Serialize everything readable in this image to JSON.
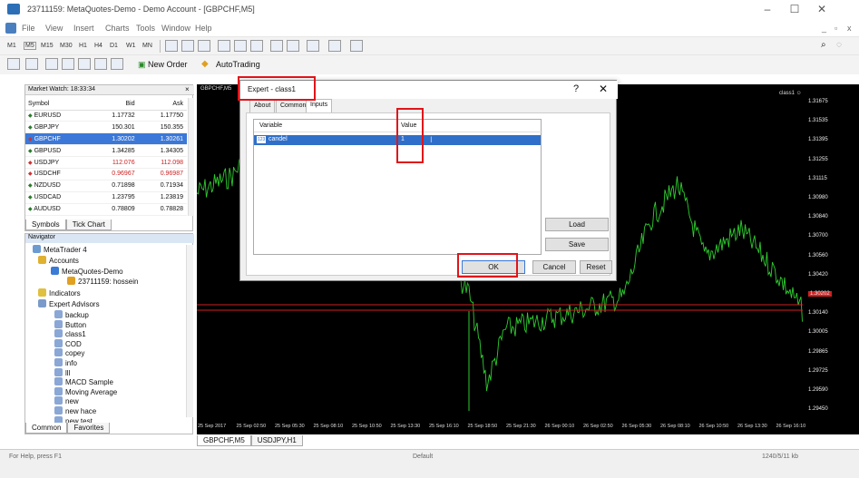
{
  "window": {
    "title": "23711159: MetaQuotes-Demo - Demo Account - [GBPCHF,M5]",
    "minimize": "–",
    "maximize": "☐",
    "close": "✕",
    "sub_minimize": "_",
    "sub_restore": "▫",
    "sub_close": "x"
  },
  "menu": [
    "File",
    "View",
    "Insert",
    "Charts",
    "Tools",
    "Window",
    "Help"
  ],
  "timeframes": [
    "M1",
    "M5",
    "M15",
    "M30",
    "H1",
    "H4",
    "D1",
    "W1",
    "MN"
  ],
  "toolbar": {
    "new_order": "New Order",
    "auto_trading": "AutoTrading"
  },
  "market_watch": {
    "title": "Market Watch: 18:33:34",
    "headers": {
      "symbol": "Symbol",
      "bid": "Bid",
      "ask": "Ask"
    },
    "rows": [
      {
        "symbol": "EURUSD",
        "bid": "1.17732",
        "ask": "1.17750",
        "dir": "up",
        "bid_color": "#111",
        "ask_color": "#111"
      },
      {
        "symbol": "GBPJPY",
        "bid": "150.301",
        "ask": "150.355",
        "dir": "up",
        "bid_color": "#111",
        "ask_color": "#111"
      },
      {
        "symbol": "GBPCHF",
        "bid": "1.30202",
        "ask": "1.30261",
        "dir": "dn",
        "selected": true
      },
      {
        "symbol": "GBPUSD",
        "bid": "1.34285",
        "ask": "1.34305",
        "dir": "up",
        "bid_color": "#111",
        "ask_color": "#111"
      },
      {
        "symbol": "USDJPY",
        "bid": "112.076",
        "ask": "112.098",
        "dir": "dn",
        "bid_color": "#c22",
        "ask_color": "#c22"
      },
      {
        "symbol": "USDCHF",
        "bid": "0.96967",
        "ask": "0.96987",
        "dir": "dn",
        "bid_color": "#c22",
        "ask_color": "#c22"
      },
      {
        "symbol": "NZDUSD",
        "bid": "0.71898",
        "ask": "0.71934",
        "dir": "up",
        "bid_color": "#111",
        "ask_color": "#111"
      },
      {
        "symbol": "USDCAD",
        "bid": "1.23795",
        "ask": "1.23819",
        "dir": "up",
        "bid_color": "#111",
        "ask_color": "#111"
      },
      {
        "symbol": "AUDUSD",
        "bid": "0.78809",
        "ask": "0.78828",
        "dir": "up",
        "bid_color": "#111",
        "ask_color": "#111"
      }
    ],
    "tabs": [
      "Symbols",
      "Tick Chart"
    ]
  },
  "navigator": {
    "title": "Navigator",
    "root": "MetaTrader 4",
    "accounts": "Accounts",
    "server": "MetaQuotes-Demo",
    "account": "23711159: hossein",
    "indicators": "Indicators",
    "experts_label": "Expert Advisors",
    "experts": [
      "backup",
      "Button",
      "class1",
      "COD",
      "copey",
      "info",
      "lll",
      "MACD Sample",
      "Moving Average",
      "new",
      "new hace",
      "new test"
    ],
    "tabs": [
      "Common",
      "Favorites"
    ]
  },
  "chart": {
    "tab_label": "GBPCHF,M5",
    "ea_label": "class1 ☺",
    "y_labels": [
      "1.31675",
      "1.31535",
      "1.31395",
      "1.31255",
      "1.31115",
      "1.30980",
      "1.30840",
      "1.30700",
      "1.30560",
      "1.30420",
      "1.30202",
      "1.30140",
      "1.30005",
      "1.29865",
      "1.29725",
      "1.29590",
      "1.29450"
    ],
    "x_labels": [
      "25 Sep 2017",
      "25 Sep 02:50",
      "25 Sep 05:30",
      "25 Sep 08:10",
      "25 Sep 10:50",
      "25 Sep 13:30",
      "25 Sep 16:10",
      "25 Sep 18:50",
      "25 Sep 21:30",
      "26 Sep 00:10",
      "26 Sep 02:50",
      "26 Sep 05:30",
      "26 Sep 08:10",
      "26 Sep 10:50",
      "26 Sep 13:30",
      "26 Sep 16:10"
    ],
    "price_tag": "1.30202",
    "line_color": "#2ecc2e",
    "price_line_color": "#d02020"
  },
  "chart_tabs": [
    "GBPCHF,M5",
    "USDJPY,H1"
  ],
  "status": {
    "left": "For Help, press F1",
    "mid": "Default",
    "right": "1240/5/11 kb"
  },
  "dialog": {
    "title": "Expert - class1",
    "help": "?",
    "close": "✕",
    "tabs": [
      "About",
      "Common",
      "Inputs"
    ],
    "col_variable": "Variable",
    "col_value": "Value",
    "row_variable": "candel",
    "row_value": "1",
    "row_icon": "123",
    "load": "Load",
    "save": "Save",
    "ok": "OK",
    "cancel": "Cancel",
    "reset": "Reset"
  }
}
